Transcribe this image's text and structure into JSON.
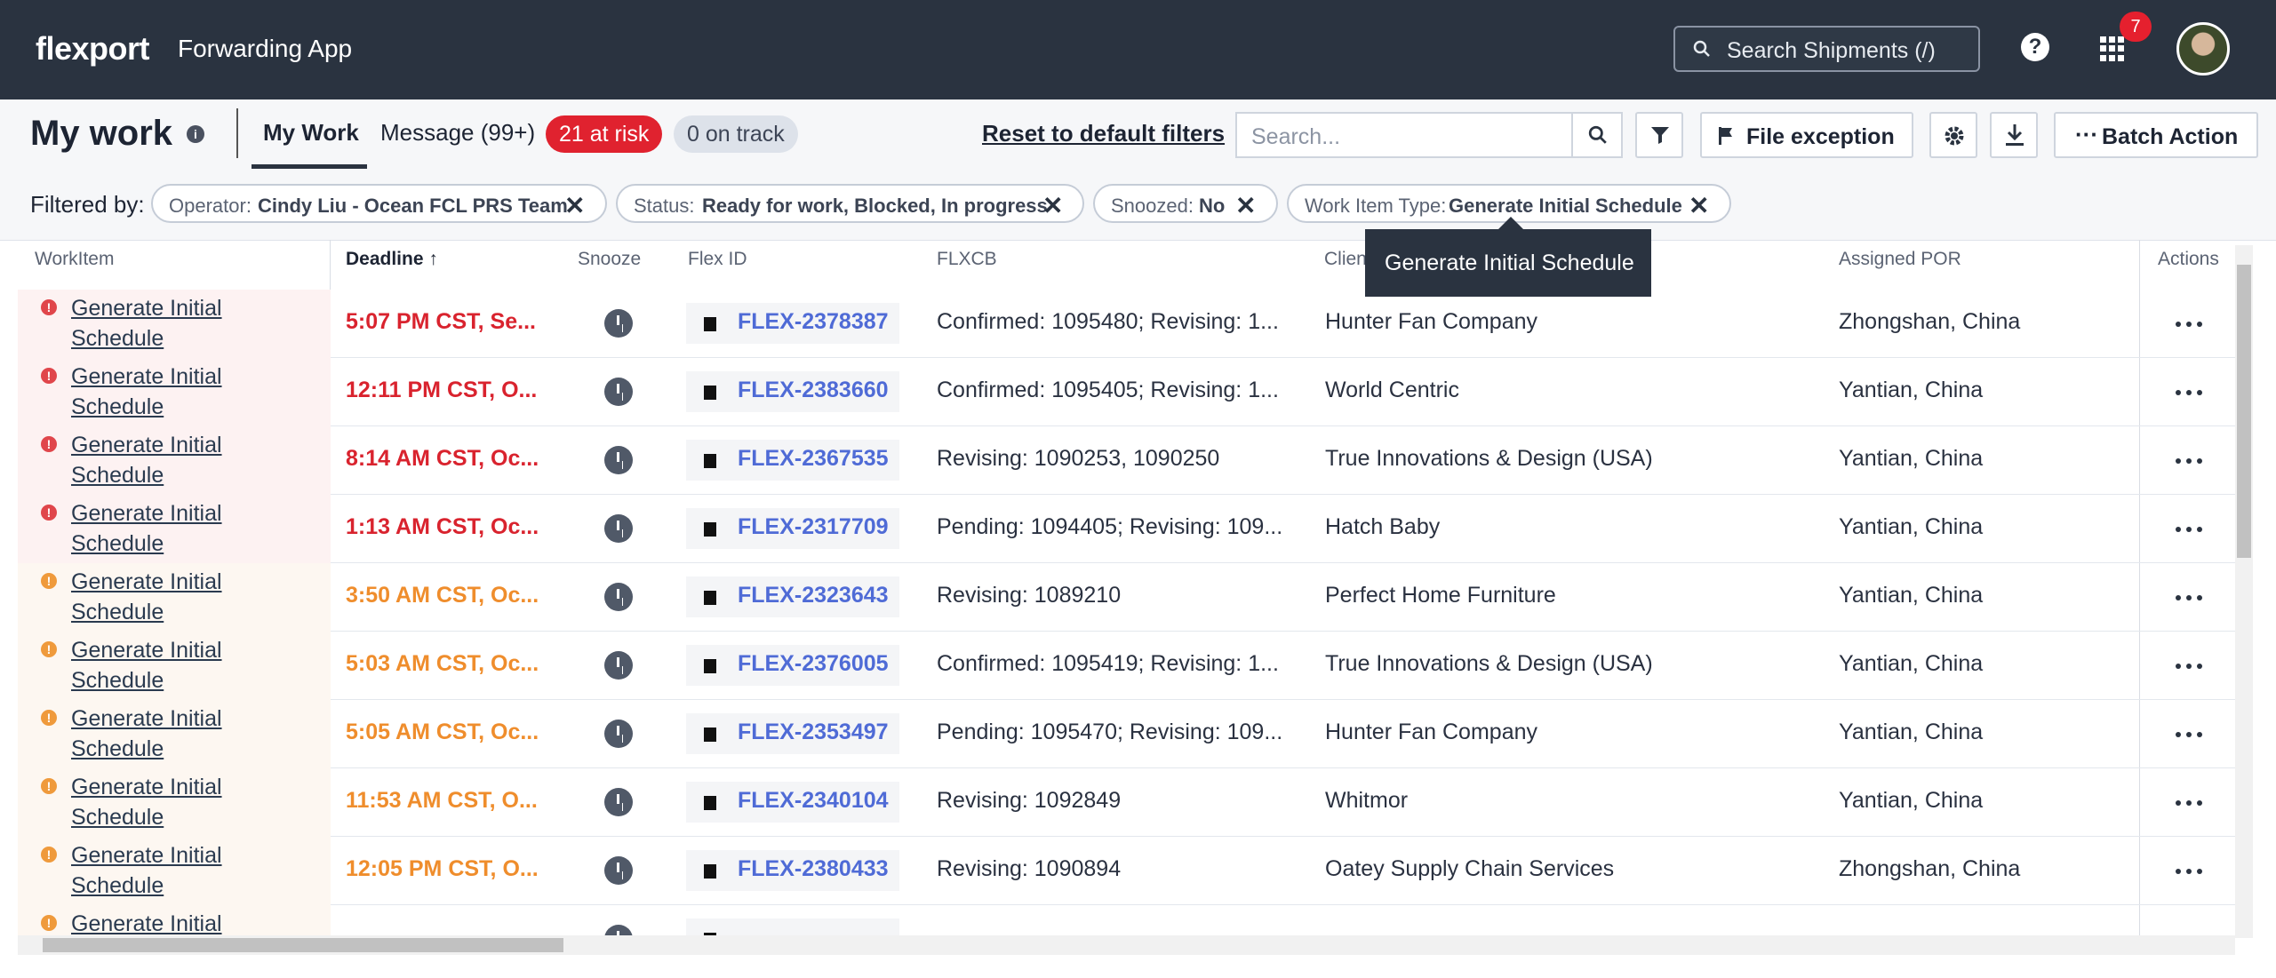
{
  "topbar": {
    "brand": "flexport",
    "app_name": "Forwarding App",
    "search_placeholder": "Search Shipments (/)",
    "help": "?",
    "notification_count": "7"
  },
  "header": {
    "title": "My work",
    "tabs": {
      "my_work": "My Work",
      "messages": "Message (99+)"
    },
    "at_risk": "21 at risk",
    "on_track": "0 on track",
    "reset": "Reset to default filters",
    "search_placeholder": "Search...",
    "file_exception": "File exception",
    "batch_action": "Batch Action"
  },
  "filters": {
    "label": "Filtered by:",
    "chips": [
      {
        "key": "Operator:",
        "value": "Cindy Liu - Ocean FCL PRS Team"
      },
      {
        "key": "Status:",
        "value": "Ready for work, Blocked, In progress"
      },
      {
        "key": "Snoozed:",
        "value": "No"
      },
      {
        "key": "Work Item Type:",
        "value": "Generate Initial Schedule"
      }
    ]
  },
  "tooltip": "Generate Initial Schedule",
  "columns": {
    "workitem": "WorkItem",
    "deadline": "Deadline",
    "snooze": "Snooze",
    "flex_id": "Flex ID",
    "flxcb": "FLXCB",
    "client": "Clien",
    "assigned_por": "Assigned POR",
    "actions": "Actions"
  },
  "rows": [
    {
      "status": "red",
      "workitem": "Generate Initial Schedule",
      "deadline": "5:07 PM CST, Se...",
      "flex_id": "FLEX-2378387",
      "flxcb": "Confirmed: 1095480; Revising: 1...",
      "client": "Hunter Fan Company",
      "por": "Zhongshan, China"
    },
    {
      "status": "red",
      "workitem": "Generate Initial Schedule",
      "deadline": "12:11 PM CST, O...",
      "flex_id": "FLEX-2383660",
      "flxcb": "Confirmed: 1095405; Revising: 1...",
      "client": "World Centric",
      "por": "Yantian, China"
    },
    {
      "status": "red",
      "workitem": "Generate Initial Schedule",
      "deadline": "8:14 AM CST, Oc...",
      "flex_id": "FLEX-2367535",
      "flxcb": "Revising: 1090253, 1090250",
      "client": "True Innovations & Design (USA)",
      "por": "Yantian, China"
    },
    {
      "status": "red",
      "workitem": "Generate Initial Schedule",
      "deadline": "1:13 AM CST, Oc...",
      "flex_id": "FLEX-2317709",
      "flxcb": "Pending: 1094405; Revising: 109...",
      "client": "Hatch Baby",
      "por": "Yantian, China"
    },
    {
      "status": "orange",
      "workitem": "Generate Initial Schedule",
      "deadline": "3:50 AM CST, Oc...",
      "flex_id": "FLEX-2323643",
      "flxcb": "Revising: 1089210",
      "client": "Perfect Home Furniture",
      "por": "Yantian, China"
    },
    {
      "status": "orange",
      "workitem": "Generate Initial Schedule",
      "deadline": "5:03 AM CST, Oc...",
      "flex_id": "FLEX-2376005",
      "flxcb": "Confirmed: 1095419; Revising: 1...",
      "client": "True Innovations & Design (USA)",
      "por": "Yantian, China"
    },
    {
      "status": "orange",
      "workitem": "Generate Initial Schedule",
      "deadline": "5:05 AM CST, Oc...",
      "flex_id": "FLEX-2353497",
      "flxcb": "Pending: 1095470; Revising: 109...",
      "client": "Hunter Fan Company",
      "por": "Yantian, China"
    },
    {
      "status": "orange",
      "workitem": "Generate Initial Schedule",
      "deadline": "11:53 AM CST, O...",
      "flex_id": "FLEX-2340104",
      "flxcb": "Revising: 1092849",
      "client": "Whitmor",
      "por": "Yantian, China"
    },
    {
      "status": "orange",
      "workitem": "Generate Initial Schedule",
      "deadline": "12:05 PM CST, O...",
      "flex_id": "FLEX-2380433",
      "flxcb": "Revising: 1090894",
      "client": "Oatey Supply Chain Services",
      "por": "Zhongshan, China"
    },
    {
      "status": "orange",
      "workitem": "Generate Initial Schedule",
      "deadline": "",
      "flex_id": "",
      "flxcb": "",
      "client": "",
      "por": ""
    }
  ]
}
